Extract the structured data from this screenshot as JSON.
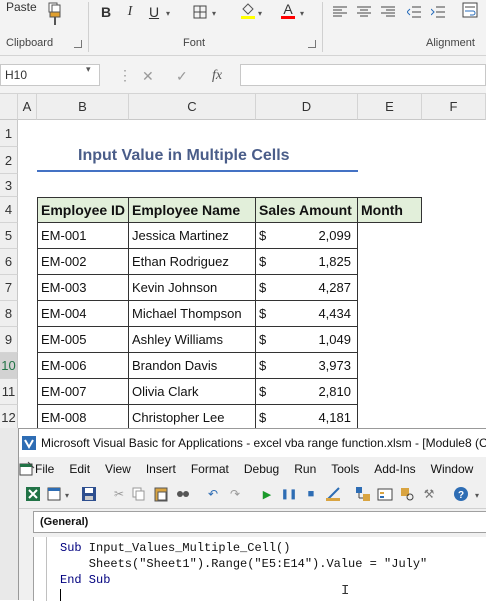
{
  "ribbon": {
    "paste_label": "Paste",
    "clipboard_label": "Clipboard",
    "font_label": "Font",
    "alignment_label": "Alignment",
    "bold": "B",
    "italic": "I",
    "underline": "U",
    "fill_color": "#ffff00",
    "font_color": "#ff0000"
  },
  "formula_bar": {
    "name_box": "H10",
    "cancel": "✕",
    "enter": "✓",
    "fx": "fx",
    "value": ""
  },
  "sheet": {
    "columns": [
      "A",
      "B",
      "C",
      "D",
      "E",
      "F"
    ],
    "rows": [
      "1",
      "2",
      "3",
      "4",
      "5",
      "6",
      "7",
      "8",
      "9",
      "10",
      "11",
      "12"
    ],
    "selected_row": "10",
    "title": "Input Value in Multiple Cells",
    "headers": [
      "Employee ID",
      "Employee Name",
      "Sales Amount",
      "Month"
    ],
    "currency": "$",
    "records": [
      {
        "id": "EM-001",
        "name": "Jessica Martinez",
        "amount": "2,099"
      },
      {
        "id": "EM-002",
        "name": "Ethan Rodriguez",
        "amount": "1,825"
      },
      {
        "id": "EM-003",
        "name": "Kevin Johnson",
        "amount": "4,287"
      },
      {
        "id": "EM-004",
        "name": "Michael Thompson",
        "amount": "4,434"
      },
      {
        "id": "EM-005",
        "name": "Ashley Williams",
        "amount": "1,049"
      },
      {
        "id": "EM-006",
        "name": "Brandon Davis",
        "amount": "3,973"
      },
      {
        "id": "EM-007",
        "name": "Olivia Clark",
        "amount": "2,810"
      },
      {
        "id": "EM-008",
        "name": "Christopher Lee",
        "amount": "4,181"
      }
    ],
    "header_fill": "#e2efda"
  },
  "vba": {
    "title": "Microsoft Visual Basic for Applications - excel vba range function.xlsm - [Module8 (C",
    "menu": [
      "File",
      "Edit",
      "View",
      "Insert",
      "Format",
      "Debug",
      "Run",
      "Tools",
      "Add-Ins",
      "Window"
    ],
    "general": "(General)",
    "code": {
      "l1_kw": "Sub",
      "l1_rest": " Input_Values_Multiple_Cell()",
      "l2": "    Sheets(\"Sheet1\").Range(\"E5:E14\").Value = \"July\"",
      "l3_kw": "End Sub"
    },
    "keyword_color": "#00007f"
  }
}
